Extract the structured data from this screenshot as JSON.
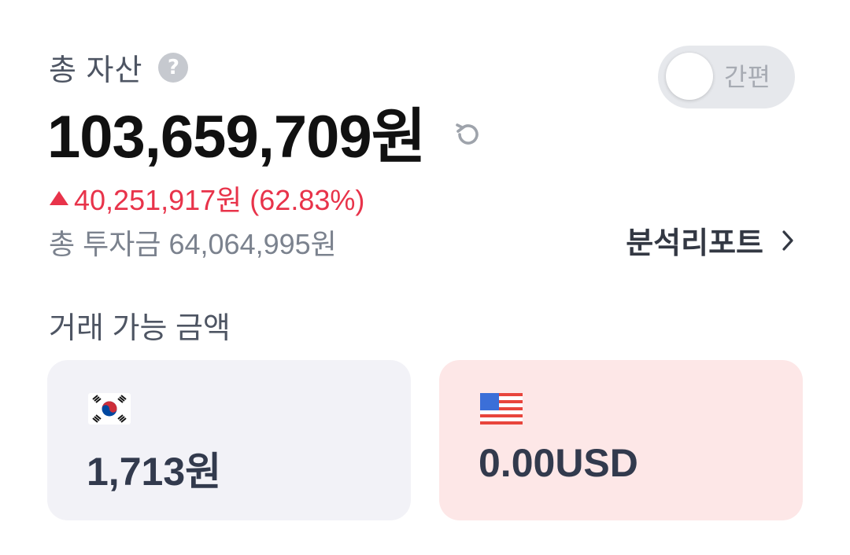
{
  "summary": {
    "label": "총 자산",
    "help_icon": "?",
    "total_amount": "103,659,709원",
    "change": "40,251,917원 (62.83%)",
    "total_investment": "총 투자금 64,064,995원",
    "report_link": "분석리포트"
  },
  "toggle": {
    "label": "간편",
    "state": "off"
  },
  "available": {
    "title": "거래 가능 금액",
    "cards": [
      {
        "currency": "KRW",
        "flag_icon": "korea-flag-icon",
        "amount": "1,713원"
      },
      {
        "currency": "USD",
        "flag_icon": "us-flag-icon",
        "amount": "0.00USD"
      }
    ]
  },
  "colors": {
    "positive": "#e8334a",
    "krw_card_bg": "#f2f2f7",
    "usd_card_bg": "#fde7e7",
    "toggle_bg": "#e6e8ec"
  },
  "icons": [
    "help-icon",
    "refresh-icon",
    "triangle-up-icon",
    "chevron-right-icon",
    "korea-flag-icon",
    "us-flag-icon"
  ]
}
